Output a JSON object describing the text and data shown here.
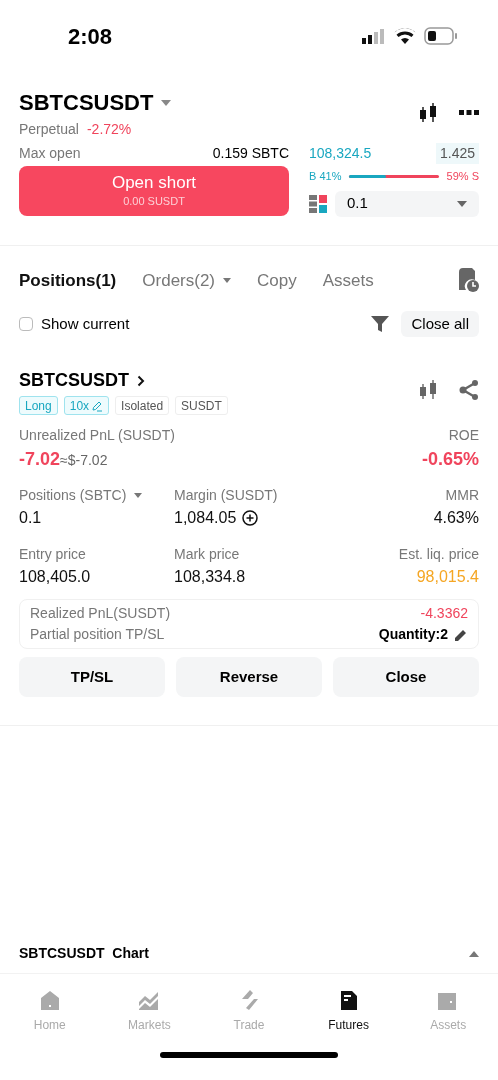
{
  "status_bar": {
    "time": "2:08"
  },
  "header": {
    "symbol": "SBTCSUSDT",
    "type": "Perpetual",
    "change": "-2.72%"
  },
  "order": {
    "max_open_label": "Max open",
    "max_open_value": "0.159 SBTC",
    "button_label": "Open short",
    "button_sub": "0.00 SUSDT"
  },
  "book": {
    "price": "108,324.5",
    "size": "1.425",
    "buy_label": "B 41%",
    "sell_label": "59% S",
    "level": 0.41,
    "step": "0.1"
  },
  "tabs": [
    {
      "label": "Positions(1)",
      "selected": true,
      "dropdown": false
    },
    {
      "label": "Orders(2)",
      "selected": false,
      "dropdown": true
    },
    {
      "label": "Copy",
      "selected": false,
      "dropdown": false
    },
    {
      "label": "Assets",
      "selected": false,
      "dropdown": false
    }
  ],
  "filter": {
    "show_current": "Show current",
    "checked": false,
    "close_all": "Close all"
  },
  "position": {
    "symbol": "SBTCSUSDT",
    "tags": [
      {
        "label": "Long",
        "kind": "side"
      },
      {
        "label": "10x",
        "kind": "leverage"
      },
      {
        "label": "Isolated",
        "kind": "plain"
      },
      {
        "label": "SUSDT",
        "kind": "plain"
      }
    ],
    "pnl_label": "Unrealized PnL (SUSDT)",
    "pnl_value": "-7.02",
    "pnl_usd": "≈$-7.02",
    "roe_label": "ROE",
    "roe_value": "-0.65%",
    "fields": [
      {
        "label": "Positions (SBTC)",
        "value": "0.1",
        "kind": "dropdown"
      },
      {
        "label": "Margin (SUSDT)",
        "value": "1,084.05",
        "kind": "add"
      },
      {
        "label": "MMR",
        "value": "4.63%",
        "kind": "plain"
      },
      {
        "label": "Entry price",
        "value": "108,405.0",
        "kind": "plain"
      },
      {
        "label": "Mark price",
        "value": "108,334.8",
        "kind": "plain"
      },
      {
        "label": "Est. liq. price",
        "value": "98,015.4",
        "kind": "warning"
      }
    ],
    "realized_label": "Realized PnL(SUSDT)",
    "realized_value": "-4.3362",
    "tpsl_label": "Partial position TP/SL",
    "tpsl_value": "Quantity:2",
    "buttons": [
      "TP/SL",
      "Reverse",
      "Close"
    ]
  },
  "chart_bar": {
    "label": "SBTCSUSDT  Chart"
  },
  "nav": [
    {
      "label": "Home",
      "selected": false
    },
    {
      "label": "Markets",
      "selected": false
    },
    {
      "label": "Trade",
      "selected": false
    },
    {
      "label": "Futures",
      "selected": true
    },
    {
      "label": "Assets",
      "selected": false
    }
  ]
}
